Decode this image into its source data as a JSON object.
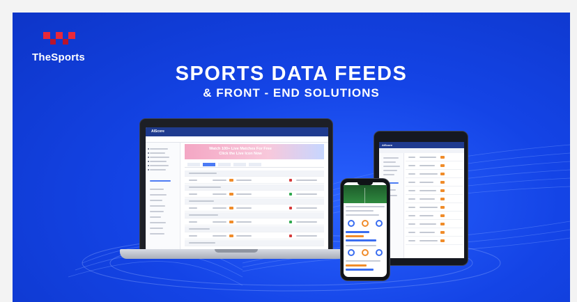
{
  "brand": {
    "name": "TheSports",
    "mark_colors": [
      "#e8283a",
      "#b8142c"
    ]
  },
  "headline": "SPORTS DATA FEEDS",
  "subheadline": "& FRONT - END SOLUTIONS",
  "laptop_app": {
    "logo": "AIScore",
    "promo_line1": "Watch 100+ Live Matches For Free",
    "promo_line2": "Click the Live Icon Now"
  },
  "colors": {
    "banner_blue": "#1444e6",
    "app_header": "#1f3b8f",
    "accent_orange": "#f08c2a",
    "accent_blue": "#4c7bf4"
  }
}
